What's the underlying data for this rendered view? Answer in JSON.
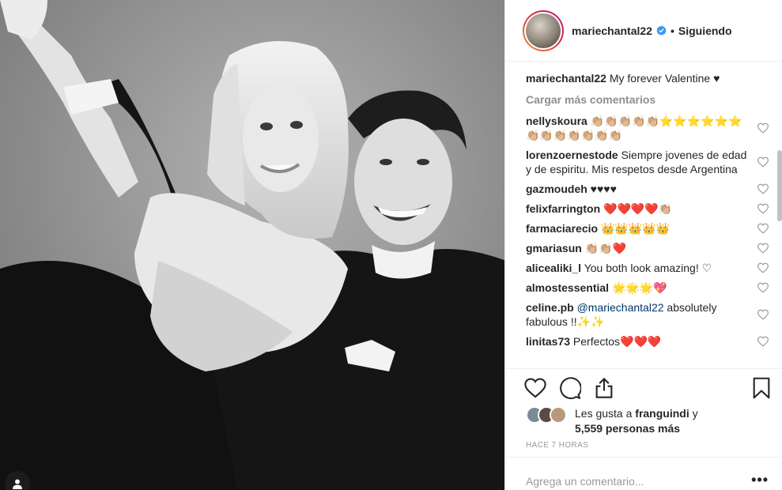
{
  "post": {
    "username": "mariechantal22",
    "follow_status": "Siguiendo",
    "caption": "My forever Valentine ♥",
    "load_more": "Cargar más comentarios",
    "time": "HACE 7 HORAS"
  },
  "comments": [
    {
      "user": "nellyskoura",
      "text": "👏🏼👏🏼👏🏼👏🏼👏🏼⭐⭐⭐⭐⭐⭐👏🏼👏🏼👏🏼👏🏼👏🏼👏🏼👏🏼"
    },
    {
      "user": "lorenzoernestode",
      "text": "Siempre jovenes de edad y de espiritu. Mis respetos desde Argentina"
    },
    {
      "user": "gazmoudeh",
      "text": "♥♥♥♥"
    },
    {
      "user": "felixfarrington",
      "text": "❤️❤️❤️❤️👏🏼"
    },
    {
      "user": "farmaciarecio",
      "text": "👑👑👑👑👑"
    },
    {
      "user": "gmariasun",
      "text": "👏🏼👏🏼❤️"
    },
    {
      "user": "alicealiki_l",
      "text": "You both look amazing! ♡"
    },
    {
      "user": "almostessential",
      "text": "🌟🌟🌟💖"
    },
    {
      "user": "celine.pb",
      "mention": "@mariechantal22",
      "text": " absolutely fabulous !!✨✨"
    },
    {
      "user": "linitas73",
      "text": "Perfectos❤️❤️❤️"
    }
  ],
  "likes": {
    "prefix": "Les gusta a ",
    "user": "franguindi",
    "suffix": " y",
    "count_text": "5,559 personas más"
  },
  "add_comment": {
    "placeholder": "Agrega un comentario...",
    "more": "•••"
  },
  "icons": [
    "heart-icon",
    "comment-icon",
    "share-icon",
    "bookmark-icon",
    "verified-badge-icon",
    "user-tag-icon"
  ],
  "colors": {
    "verified": "#3897f0",
    "muted": "#8e8e8e",
    "link": "#003569",
    "border": "#efefef"
  }
}
